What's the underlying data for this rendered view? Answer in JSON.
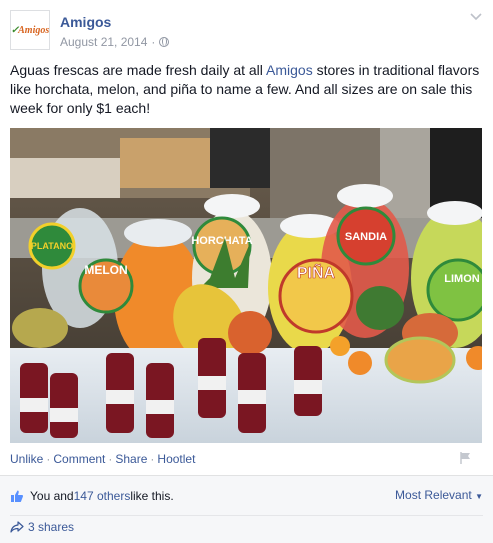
{
  "post": {
    "author": "Amigos",
    "avatar_logo": "Amigos",
    "date": "August 21, 2014",
    "separator": "·",
    "text_before": "Aguas frescas are made fresh daily at all ",
    "text_link": "Amigos",
    "text_after": " stores in traditional flavors like horchata, melon, and piña to name a few. And all sizes are on sale this week for only $1 each!",
    "photo_signs": [
      "PLATANO",
      "MELON",
      "HORCHATA",
      "PIÑA",
      "SANDIA",
      "LIMON"
    ]
  },
  "actions": {
    "unlike": "Unlike",
    "comment": "Comment",
    "share": "Share",
    "hootlet": "Hootlet",
    "dot": "·"
  },
  "footer": {
    "likes_prefix": "You and ",
    "likes_link": "147 others",
    "likes_suffix": " like this.",
    "most_relevant": "Most Relevant",
    "shares": "3 shares"
  },
  "colors": {
    "link": "#3b5998",
    "meta": "#9197a3",
    "footer_bg": "#f6f7f9"
  },
  "icons": [
    "globe-icon",
    "chevron-down-icon",
    "flag-icon",
    "like-thumb-icon",
    "share-arrow-icon"
  ]
}
